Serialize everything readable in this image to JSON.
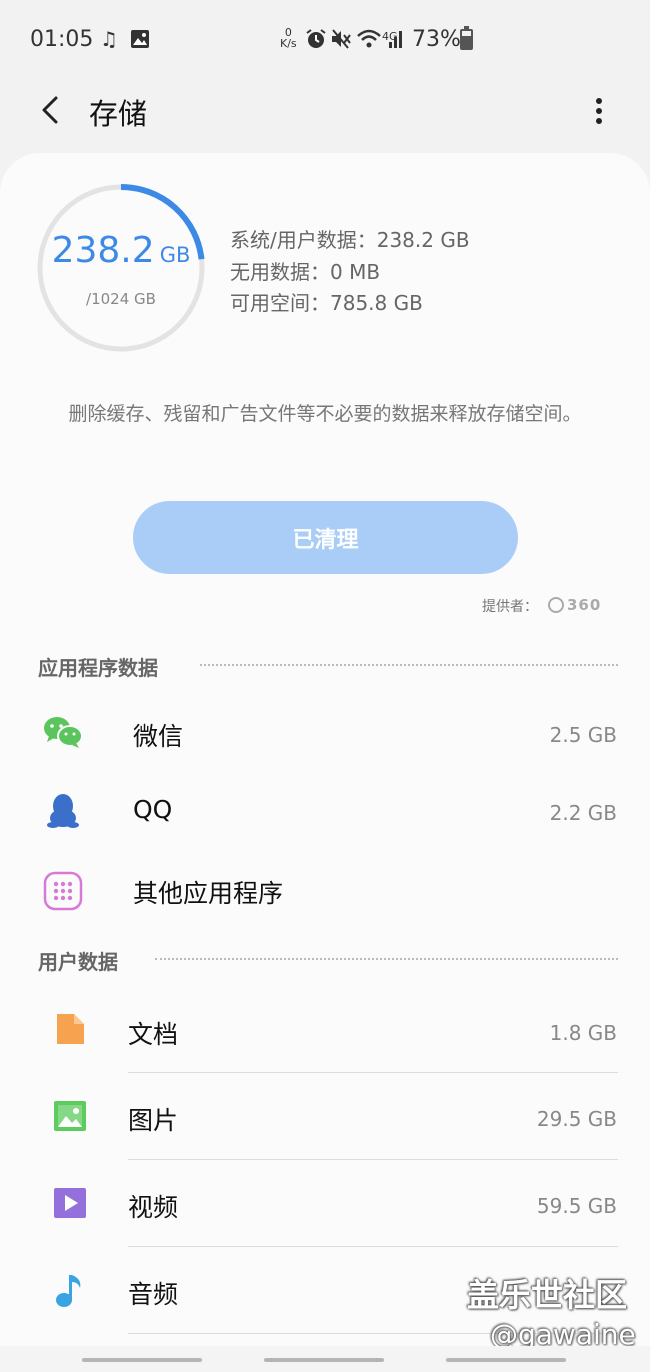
{
  "status_bar": {
    "time": "01:05",
    "net_speed_value": "0",
    "net_speed_unit": "K/s",
    "network_type": "4G",
    "battery": "73%",
    "icons": [
      "music-note-icon",
      "image-icon",
      "alarm-icon",
      "mute-icon",
      "wifi-icon",
      "signal-icon",
      "battery-icon"
    ]
  },
  "header": {
    "title": "存储",
    "back_icon": "back-arrow-icon",
    "more_icon": "more-vertical-icon"
  },
  "storage": {
    "used_value": "238.2",
    "used_unit": "GB",
    "total": "/1024 GB",
    "used_fraction": 0.2326,
    "accent_color": "#3d8ae6",
    "stats": [
      "系统/用户数据：238.2 GB",
      "无用数据：0 MB",
      "可用空间：785.8 GB"
    ]
  },
  "description": "删除缓存、残留和广告文件等不必要的数据来释放存储空间。",
  "clean_button": {
    "label": "已清理",
    "color": "#aacdf8"
  },
  "provider": {
    "label": "提供者：",
    "logo_text": "360"
  },
  "app_section": {
    "title": "应用程序数据",
    "items": [
      {
        "label": "微信",
        "size": "2.5 GB",
        "icon": "wechat-icon",
        "color": "#5cc45c"
      },
      {
        "label": "QQ",
        "size": "2.2 GB",
        "icon": "qq-icon",
        "color": "#3b6fc9"
      },
      {
        "label": "其他应用程序",
        "size": "",
        "icon": "apps-grid-icon",
        "color": "#d67ad6"
      }
    ]
  },
  "user_section": {
    "title": "用户数据",
    "items": [
      {
        "label": "文档",
        "size": "1.8 GB",
        "icon": "document-icon",
        "color": "#f7a24f"
      },
      {
        "label": "图片",
        "size": "29.5 GB",
        "icon": "picture-icon",
        "color": "#5dcb5d"
      },
      {
        "label": "视频",
        "size": "59.5 GB",
        "icon": "video-icon",
        "color": "#9370db"
      },
      {
        "label": "音频",
        "size": "",
        "icon": "audio-note-icon",
        "color": "#3aa3e3"
      }
    ]
  },
  "watermark": {
    "title": "盖乐世社区",
    "user": "@gawaine"
  }
}
